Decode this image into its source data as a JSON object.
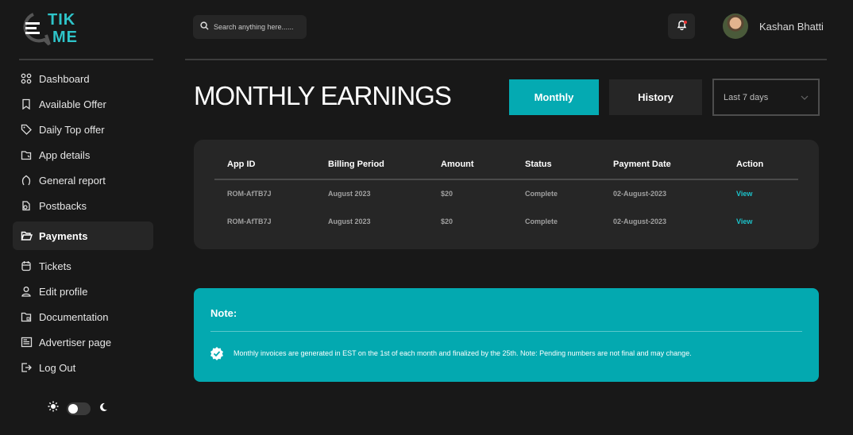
{
  "brand": {
    "logo_line1": "TIK",
    "logo_line2": "ME"
  },
  "sidebar": {
    "items": [
      {
        "label": "Dashboard",
        "icon": "grid-icon"
      },
      {
        "label": "Available Offer",
        "icon": "bookmark-icon"
      },
      {
        "label": "Daily Top offer",
        "icon": "tag-icon"
      },
      {
        "label": "App details",
        "icon": "app-file-icon"
      },
      {
        "label": "General report",
        "icon": "report-icon"
      },
      {
        "label": "Postbacks",
        "icon": "postback-icon"
      },
      {
        "label": "Payments",
        "icon": "folder-open-icon",
        "active": true
      },
      {
        "label": "Tickets",
        "icon": "calendar-icon"
      },
      {
        "label": "Edit profile",
        "icon": "user-icon"
      },
      {
        "label": "Documentation",
        "icon": "folder-doc-icon"
      },
      {
        "label": "Advertiser page",
        "icon": "advertiser-icon"
      },
      {
        "label": "Log Out",
        "icon": "logout-icon"
      }
    ],
    "theme": {
      "light_icon": "sun-icon",
      "dark_icon": "moon-icon",
      "dark_mode": false
    }
  },
  "header": {
    "search_placeholder": "Search anything here......",
    "user_name": "Kashan Bhatti"
  },
  "main": {
    "title": "MONTHLY EARNINGS",
    "tabs": {
      "monthly": "Monthly",
      "history": "History"
    },
    "range_select": {
      "value": "Last 7 days"
    },
    "table": {
      "columns": [
        "App ID",
        "Billing Period",
        "Amount",
        "Status",
        "Payment Date",
        "Action"
      ],
      "rows": [
        {
          "app_id": "ROM-AfTB7J",
          "billing_period": "August 2023",
          "amount": "$20",
          "status": "Complete",
          "payment_date": "02-August-2023",
          "action": "View"
        },
        {
          "app_id": "ROM-AfTB7J",
          "billing_period": "August 2023",
          "amount": "$20",
          "status": "Complete",
          "payment_date": "02-August-2023",
          "action": "View"
        }
      ]
    },
    "note": {
      "title": "Note:",
      "text": "Monthly invoices are generated in EST on the 1st of each month and finalized by the 25th. Note: Pending numbers are not final and may change."
    }
  },
  "colors": {
    "accent": "#04aab2",
    "background": "#181818",
    "card": "#262626",
    "link": "#1cc3cb"
  }
}
